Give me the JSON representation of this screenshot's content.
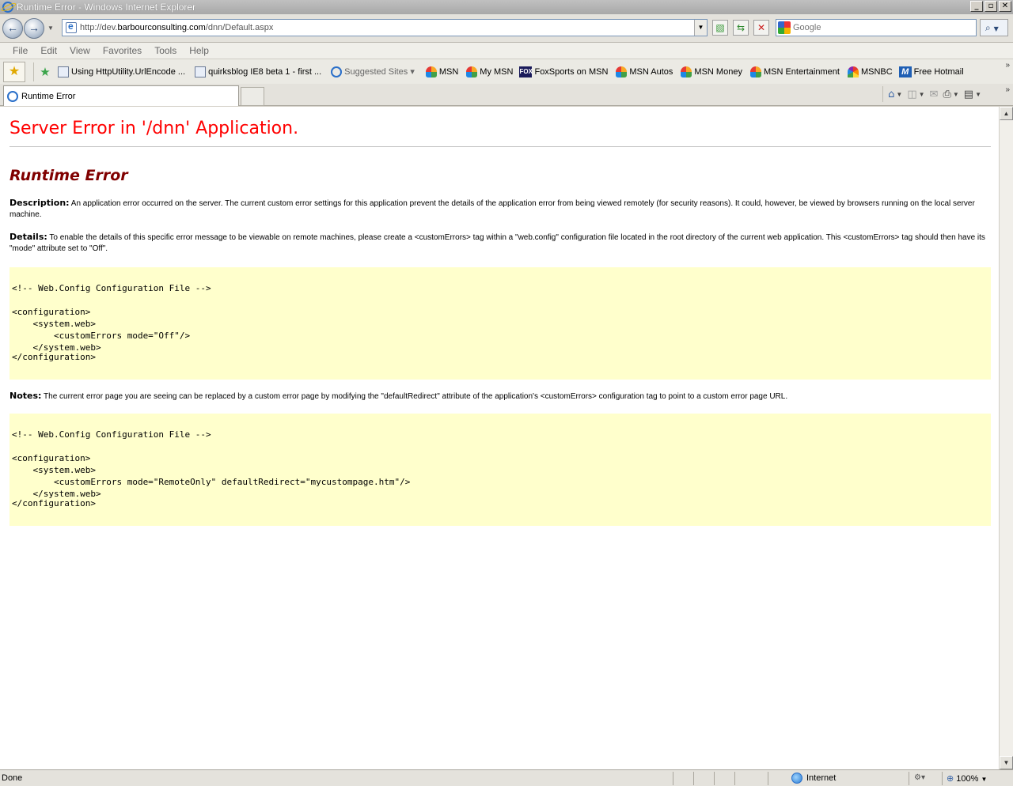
{
  "window": {
    "title": "Runtime Error - Windows Internet Explorer",
    "minimize": "_",
    "maximize": "▫",
    "close": "✕"
  },
  "address": {
    "url_prefix": "http://dev.",
    "url_domain": "barbourconsulting.com",
    "url_path": "/dnn/Default.aspx"
  },
  "search": {
    "placeholder": "Google"
  },
  "menu": [
    "File",
    "Edit",
    "View",
    "Favorites",
    "Tools",
    "Help"
  ],
  "favorites": [
    {
      "label": "Using HttpUtility.UrlEncode ...",
      "icon": "page-icon"
    },
    {
      "label": "quirksblog IE8 beta 1 - first ...",
      "icon": "ie-page-icon"
    },
    {
      "label": "Suggested Sites ▾",
      "icon": "ie-icon"
    },
    {
      "label": "MSN",
      "icon": "msn-icon"
    },
    {
      "label": "My MSN",
      "icon": "msn-icon"
    },
    {
      "label": "FoxSports on MSN",
      "icon": "fox-icon"
    },
    {
      "label": "MSN Autos",
      "icon": "msn-icon"
    },
    {
      "label": "MSN Money",
      "icon": "msn-icon"
    },
    {
      "label": "MSN Entertainment",
      "icon": "msn-icon"
    },
    {
      "label": "MSNBC",
      "icon": "nbc-icon"
    },
    {
      "label": "Free Hotmail",
      "icon": "hotmail-icon"
    }
  ],
  "tab": {
    "label": "Runtime Error"
  },
  "page": {
    "title": "Server Error in '/dnn' Application.",
    "subtitle": "Runtime Error",
    "description_label": "Description:",
    "description_text": "An application error occurred on the server. The current custom error settings for this application prevent the details of the application error from being viewed remotely (for security reasons). It could, however, be viewed by browsers running on the local server machine.",
    "details_label": "Details:",
    "details_text": "To enable the details of this specific error message to be viewable on remote machines, please create a <customErrors> tag within a \"web.config\" configuration file located in the root directory of the current web application. This <customErrors> tag should then have its \"mode\" attribute set to \"Off\".",
    "code1": [
      "<!-- Web.Config Configuration File -->",
      "",
      "<configuration>",
      "    <system.web>",
      "        <customErrors mode=\"Off\"/>",
      "    </system.web>",
      "</configuration>"
    ],
    "notes_label": "Notes:",
    "notes_text": "The current error page you are seeing can be replaced by a custom error page by modifying the \"defaultRedirect\" attribute of the application's <customErrors> configuration tag to point to a custom error page URL.",
    "code2": [
      "<!-- Web.Config Configuration File -->",
      "",
      "<configuration>",
      "    <system.web>",
      "        <customErrors mode=\"RemoteOnly\" defaultRedirect=\"mycustompage.htm\"/>",
      "    </system.web>",
      "</configuration>"
    ]
  },
  "status": {
    "text": "Done",
    "zone": "Internet",
    "zoom": "100%"
  }
}
